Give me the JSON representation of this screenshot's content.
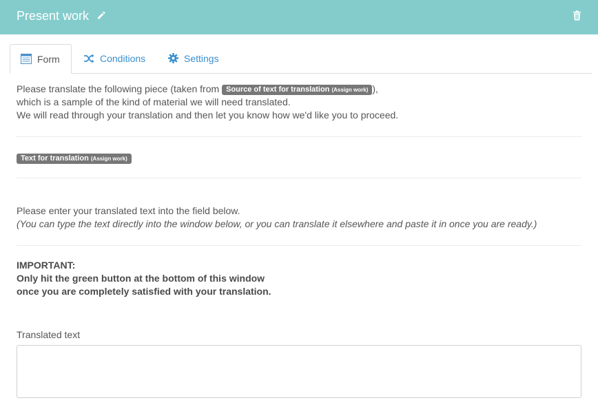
{
  "header": {
    "title": "Present work",
    "edit_icon": "pencil-icon",
    "delete_icon": "trash-icon",
    "background": "#84cccc"
  },
  "tabs": [
    {
      "label": "Form",
      "icon": "form-icon",
      "active": true
    },
    {
      "label": "Conditions",
      "icon": "shuffle-icon",
      "active": false
    },
    {
      "label": "Settings",
      "icon": "gear-icon",
      "active": false
    }
  ],
  "intro": {
    "line1_before": "Please translate the following piece (taken from ",
    "source_badge": "Source of text for translation",
    "source_badge_small": "(Assign work)",
    "line1_after": "),",
    "line2": "which is a sample of the kind of material we will need translated.",
    "line3": "We will read through your translation and then let you know how we'd like you to proceed."
  },
  "text_badge": {
    "label": "Text for translation",
    "small": "(Assign work)"
  },
  "instructions": {
    "line1": "Please enter your translated text into the field below.",
    "line2": "(You can type the text directly into the window below, or you can translate it elsewhere and paste it in once you are ready.)"
  },
  "important": {
    "heading": "IMPORTANT:",
    "line1": "Only hit the green button at the bottom of this window",
    "line2": "once you are completely satisfied with your translation."
  },
  "translated_field": {
    "label": "Translated text",
    "value": ""
  },
  "colors": {
    "accent": "#3a8fce",
    "badge": "#777777"
  }
}
